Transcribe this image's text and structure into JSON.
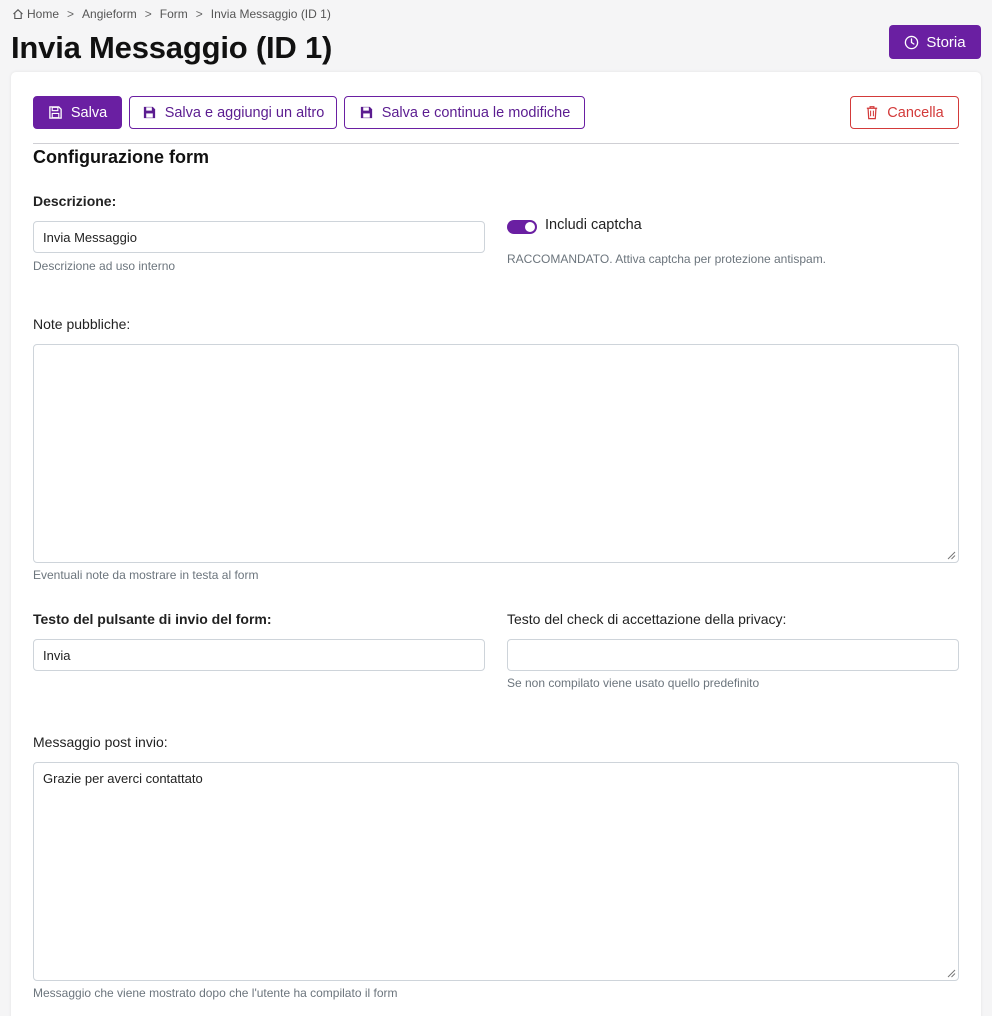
{
  "breadcrumb": {
    "home": "Home",
    "items": [
      "Angieform",
      "Form"
    ],
    "current": "Invia Messaggio (ID 1)"
  },
  "page_title": "Invia Messaggio (ID 1)",
  "history_button": "Storia",
  "toolbar": {
    "save": "Salva",
    "save_add": "Salva e aggiungi un altro",
    "save_continue": "Salva e continua le modifiche",
    "delete": "Cancella"
  },
  "section_title": "Configurazione form",
  "fields": {
    "description": {
      "label": "Descrizione:",
      "value": "Invia Messaggio",
      "help": "Descrizione ad uso interno"
    },
    "captcha": {
      "label": "Includi captcha",
      "checked": true,
      "help": "RACCOMANDATO. Attiva captcha per protezione antispam."
    },
    "public_notes": {
      "label": "Note pubbliche:",
      "value": "",
      "help": "Eventuali note da mostrare in testa al form"
    },
    "submit_text": {
      "label": "Testo del pulsante di invio del form:",
      "value": "Invia"
    },
    "privacy_text": {
      "label": "Testo del check di accettazione della privacy:",
      "value": "",
      "help": "Se non compilato viene usato quello predefinito"
    },
    "post_message": {
      "label": "Messaggio post invio:",
      "value": "Grazie per averci contattato",
      "help": "Messaggio che viene mostrato dopo che l'utente ha compilato il form"
    }
  },
  "colors": {
    "accent": "#6a1fa2",
    "danger": "#d33a3a"
  }
}
